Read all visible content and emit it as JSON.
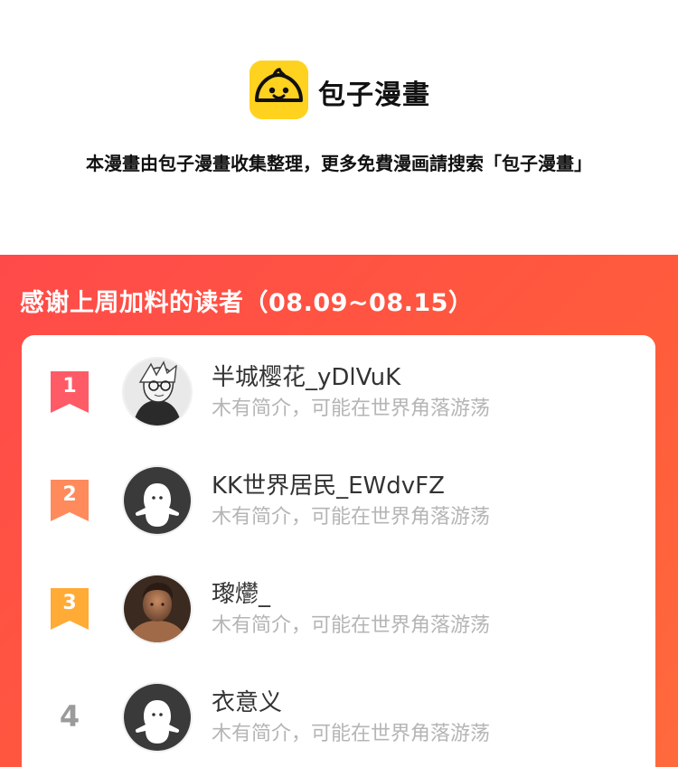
{
  "brand": {
    "name": "包子漫畫",
    "logo_icon": "steamed-bun-icon",
    "logo_color": "#ffd21f"
  },
  "notice": "本漫畫由包子漫畫收集整理，更多免費漫画請搜索「包子漫畫」",
  "leaderboard": {
    "title": "感谢上周加料的读者（08.09~08.15）",
    "accent_color": "#ff4f45",
    "readers": [
      {
        "rank": "1",
        "name": "半城樱花_yDlVuK",
        "bio": "木有简介，可能在世界角落游荡",
        "avatar": "sketch-portrait",
        "badge_color": "#ff5b67"
      },
      {
        "rank": "2",
        "name": "KK世界居民_EWdvFZ",
        "bio": "木有简介，可能在世界角落游荡",
        "avatar": "default-ghost",
        "badge_color": "#ff8a5c"
      },
      {
        "rank": "3",
        "name": "瓈爩_",
        "bio": "木有简介，可能在世界角落游荡",
        "avatar": "photo-portrait",
        "badge_color": "#ffab36"
      },
      {
        "rank": "4",
        "name": "衣意义",
        "bio": "木有简介，可能在世界角落游荡",
        "avatar": "default-ghost",
        "badge_color": "#9b9b9b"
      }
    ]
  }
}
